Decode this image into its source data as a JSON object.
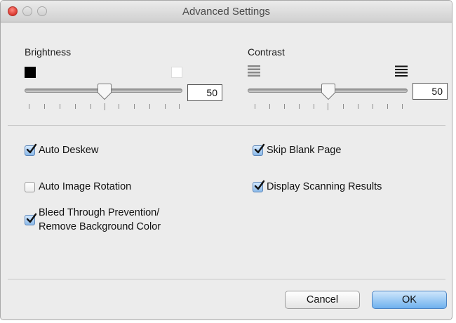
{
  "window": {
    "title": "Advanced Settings"
  },
  "brightness": {
    "label": "Brightness",
    "value": "50",
    "slider_fraction": 0.5,
    "icon_low": "black-square-icon",
    "icon_high": "white-square-icon"
  },
  "contrast": {
    "label": "Contrast",
    "value": "50",
    "slider_fraction": 0.5,
    "icon_low": "low-contrast-lines-icon",
    "icon_high": "high-contrast-lines-icon"
  },
  "options": {
    "auto_deskew": {
      "label": "Auto Deskew",
      "checked": true
    },
    "skip_blank": {
      "label": "Skip Blank Page",
      "checked": true
    },
    "auto_rotation": {
      "label": "Auto Image Rotation",
      "checked": false
    },
    "display_results": {
      "label": "Display Scanning Results",
      "checked": true
    },
    "bleed_through": {
      "label_line1": "Bleed Through Prevention/",
      "label_line2": "Remove Background Color",
      "checked": true
    }
  },
  "buttons": {
    "cancel": "Cancel",
    "ok": "OK"
  },
  "colors": {
    "checkbox_blue": "#8ab8e8",
    "ok_button_blue": "#6fb1ee",
    "close_red": "#d9372f"
  }
}
